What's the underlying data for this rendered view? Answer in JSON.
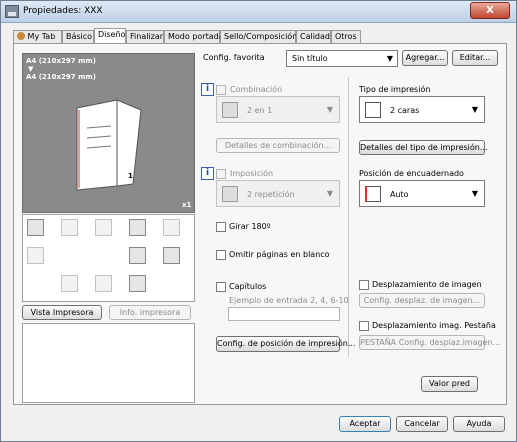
{
  "window": {
    "title": "Propiedades: XXX",
    "close_glyph": "X"
  },
  "tabs": [
    {
      "label": "My Tab"
    },
    {
      "label": "Básico"
    },
    {
      "label": "Diseño"
    },
    {
      "label": "Finalizar"
    },
    {
      "label": "Modo portada"
    },
    {
      "label": "Sello/Composición"
    },
    {
      "label": "Calidad"
    },
    {
      "label": "Otros"
    }
  ],
  "active_tab": "Diseño",
  "favorite": {
    "label": "Config. favorita",
    "value": "Sin título",
    "add_label": "Agregar...",
    "edit_label": "Editar..."
  },
  "preview": {
    "paper_line1": "A4 (210x297 mm)",
    "arrow": "▼",
    "paper_line2": "A4 (210x297 mm)",
    "copies": "x1",
    "page_number": "1"
  },
  "left_buttons": {
    "printer_view": "Vista Impresora",
    "printer_info": "Info. impresora"
  },
  "combination": {
    "checkbox_label": "Combinación",
    "value": "2 en 1",
    "details_button": "Detalles de combinación..."
  },
  "imposition": {
    "checkbox_label": "Imposición",
    "value": "2 repetición"
  },
  "rotate": {
    "label": "Girar 180º"
  },
  "skip_blank": {
    "label": "Omitir páginas en blanco"
  },
  "chapters": {
    "label": "Capítulos",
    "example": "Ejemplo de entrada 2, 4, 6-10",
    "value": ""
  },
  "staple_position_button": "Config. de posición de impresión...",
  "print_type": {
    "label": "Tipo de impresión",
    "value": "2 caras",
    "details_button": "Detalles del tipo de impresión..."
  },
  "binding": {
    "label": "Posición de encuadernado",
    "value": "Auto"
  },
  "image_shift": {
    "label": "Desplazamiento de imagen",
    "button": "Config. desplaz. de imagen..."
  },
  "tab_shift": {
    "label": "Desplazamiento imag. Pestaña",
    "button": "PESTAÑA Config. desplaz.imagen..."
  },
  "default_button": "Valor pred",
  "footer": {
    "ok": "Aceptar",
    "cancel": "Cancelar",
    "help": "Ayuda"
  }
}
